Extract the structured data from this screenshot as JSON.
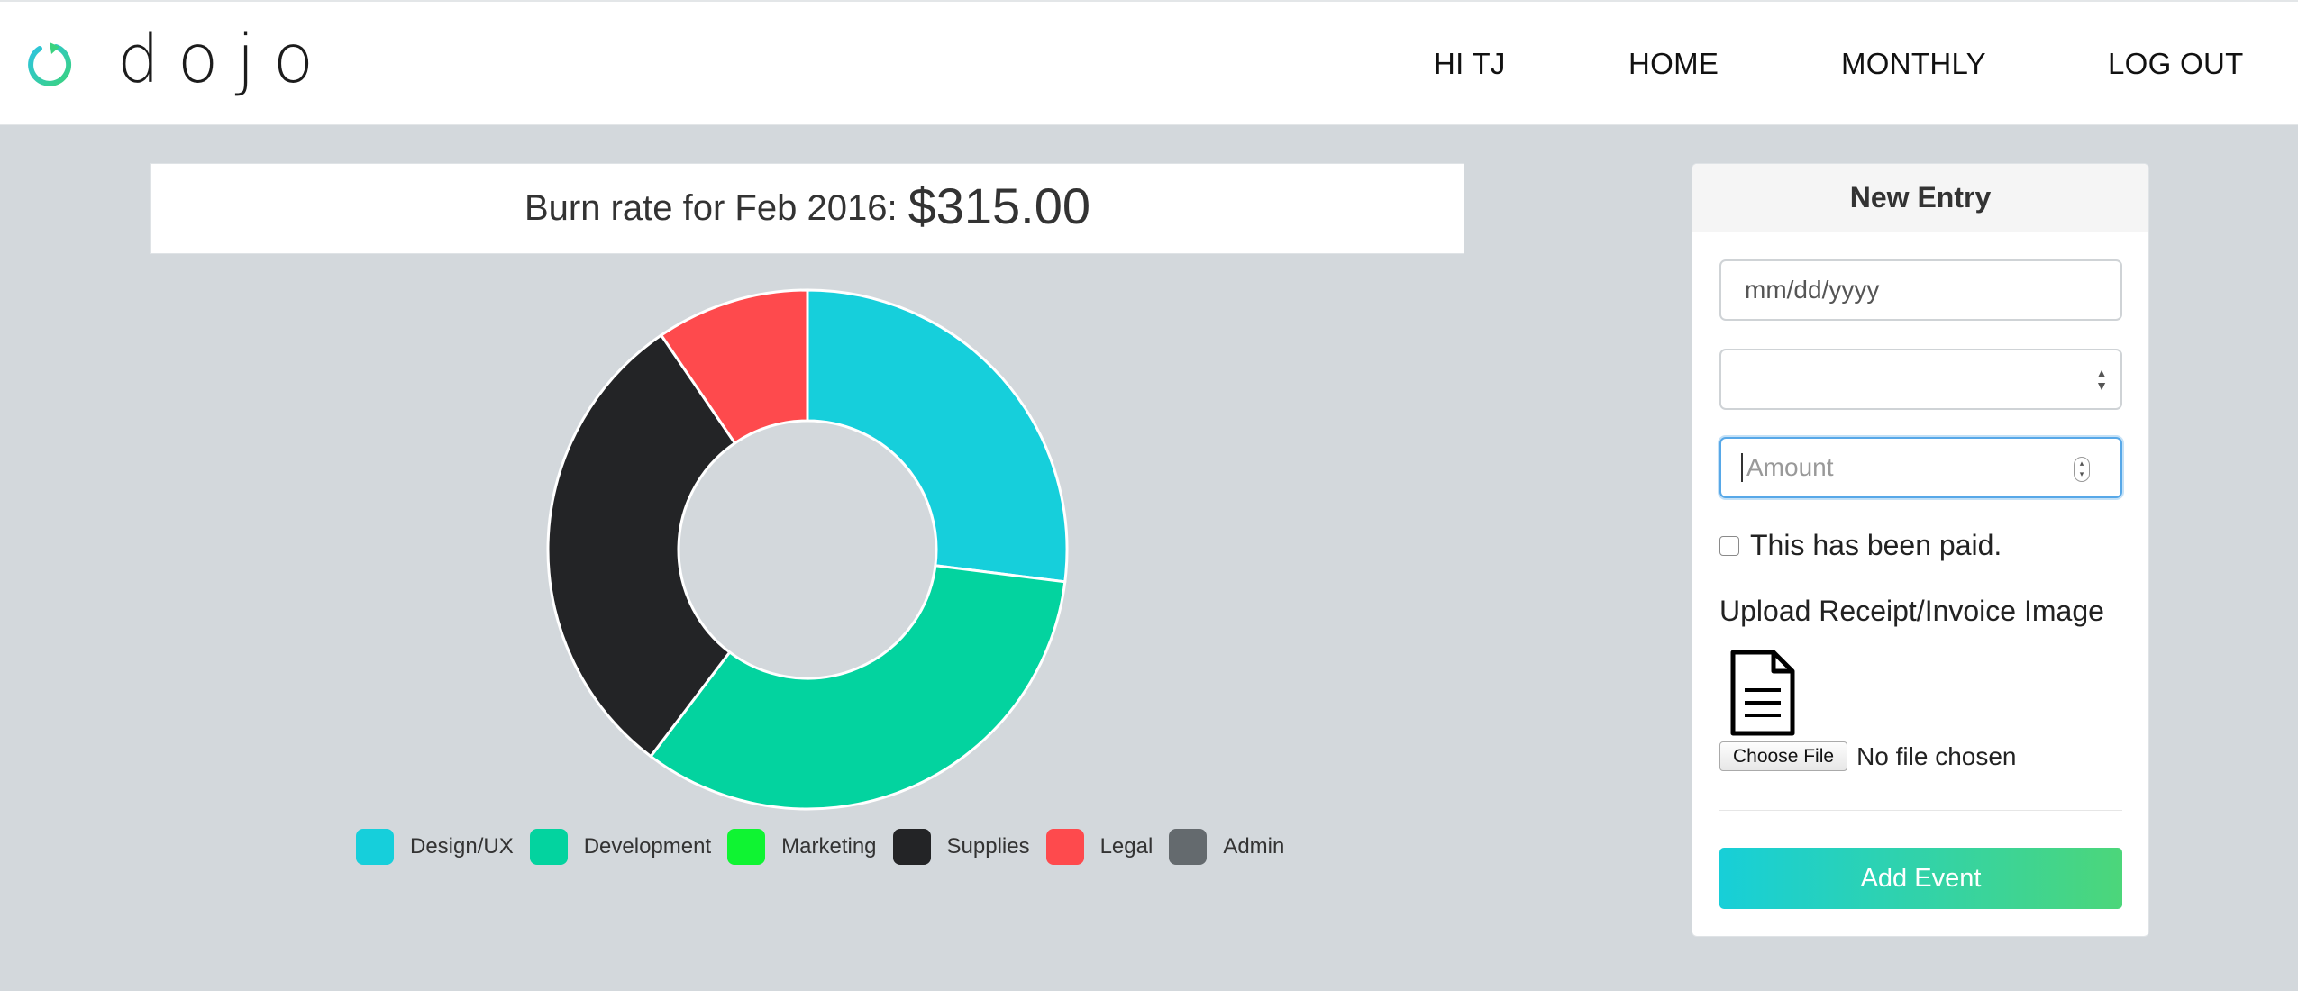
{
  "brand": {
    "name": "dojo",
    "colors": [
      "#2dc4e0",
      "#3ad27f"
    ]
  },
  "nav": {
    "greeting": "HI TJ",
    "home": "HOME",
    "monthly": "MONTHLY",
    "logout": "LOG OUT"
  },
  "summary": {
    "label": "Burn rate for Feb 2016:",
    "amount": "$315.00"
  },
  "chart_data": {
    "type": "pie",
    "style": "doughnut",
    "legend_position": "bottom",
    "categories": [
      "Design/UX",
      "Development",
      "Marketing",
      "Supplies",
      "Legal",
      "Admin"
    ],
    "values": [
      85,
      105,
      0,
      95,
      30,
      0
    ],
    "colors": [
      "#16cfdb",
      "#03d39f",
      "#0ff432",
      "#232426",
      "#fe4a4d",
      "#646a6e"
    ],
    "slice_border": "#ffffff"
  },
  "form": {
    "title": "New Entry",
    "date_placeholder": "mm/dd/yyyy",
    "category_value": "",
    "amount_placeholder": "Amount",
    "paid_label": "This has been paid.",
    "paid_checked": false,
    "upload_label": "Upload Receipt/Invoice Image",
    "upload_icon": "document-icon",
    "choose_file_label": "Choose File",
    "file_status": "No file chosen",
    "submit_label": "Add Event",
    "submit_gradient": [
      "#17cfd8",
      "#4cd67a"
    ],
    "amount_focus_color": "#57a8e8"
  }
}
